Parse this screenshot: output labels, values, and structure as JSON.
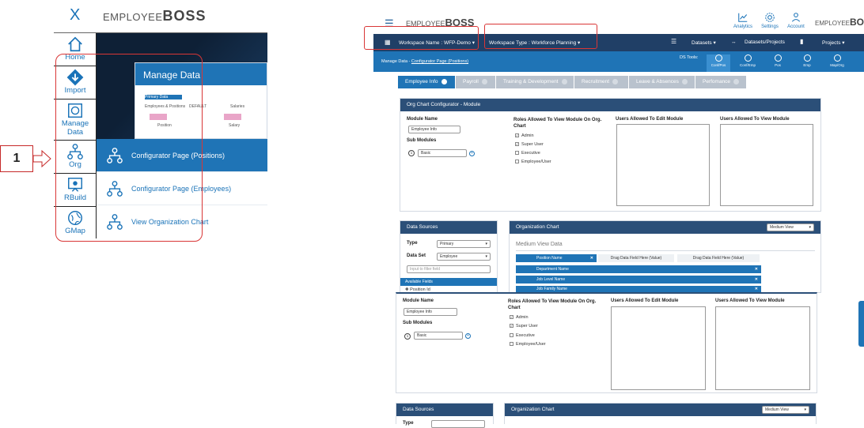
{
  "left": {
    "close": "X",
    "logo_pre": "EMPLOYEE",
    "logo_main": "BOSS",
    "nav": [
      {
        "label": "Home",
        "icon": "home-icon"
      },
      {
        "label": "Import",
        "icon": "import-icon"
      },
      {
        "label": "Manage Data",
        "label2": "Data",
        "label1": "Manage",
        "icon": "manage-data-icon"
      },
      {
        "label": "Org",
        "icon": "org-icon"
      },
      {
        "label": "RBuild",
        "icon": "rbuild-icon"
      },
      {
        "label": "GMap",
        "icon": "gmap-icon"
      }
    ],
    "manage_card_title": "Manage Data",
    "card_primary": "Primary Data",
    "card_emp": "Employees & Positions",
    "card_default": "DEFAULT",
    "card_salaries": "Salaries",
    "card_position": "Position",
    "card_salary": "Salary",
    "org_menu": [
      {
        "label": "Configurator Page (Positions)"
      },
      {
        "label": "Configurator Page (Employees)"
      },
      {
        "label": "View Organization Chart"
      }
    ],
    "callout": "1"
  },
  "right": {
    "logo_pre": "EMPLOYEE",
    "logo_main": "BOSS",
    "top_icons": [
      "Analytics",
      "Settings",
      "Account"
    ],
    "workspace_name": "Workspace Name : WFP-Demo",
    "workspace_type": "Workspace Type : Workforce Planning",
    "menu": [
      "Datasets",
      "Datasets/Projects",
      "Projects"
    ],
    "breadcrumb_root": "Manage Data",
    "breadcrumb_current": "Configurator Page (Positions)",
    "ds_tools_label": "DS Tools:",
    "ds_tools": [
      "Conf/Pos",
      "Conf/Emp",
      "Pos",
      "Emp",
      "Map/Org"
    ],
    "tabs": [
      "Employee Info",
      "Payroll",
      "Training & Development",
      "Recruitment",
      "Leave & Absences",
      "Perfomance"
    ],
    "configurator_title": "Org Chart Configurator - Module",
    "module_name_label": "Module Name",
    "module_name_value": "Employee Info",
    "sub_modules_label": "Sub Modules",
    "sub_module_index": "1",
    "sub_module_value": "Basic",
    "roles_label": "Roles Allowed To View Module On Org. Chart",
    "roles": [
      {
        "label": "Admin",
        "checked": true
      },
      {
        "label": "Super User",
        "checked": true
      },
      {
        "label": "Executive",
        "checked": false
      },
      {
        "label": "Employee/User",
        "checked": false
      }
    ],
    "users_edit_label": "Users Allowed To Edit Module",
    "users_view_label": "Users Allowed To View Module",
    "data_sources_title": "Data Sources",
    "type_label": "Type",
    "type_value": "Primary",
    "dataset_label": "Data Set",
    "dataset_value": "Employee",
    "filter_placeholder": "Input to filter field",
    "available_fields": "Available Fields",
    "field_item": "Position Id",
    "org_chart_title": "Organization Chart",
    "view_select": "Medium View",
    "medium_view_data": "Medium View Data",
    "position_name": "Position Name",
    "drag_here": "Drag Data Field Here (Value)",
    "fields": [
      "Department Name",
      "Job Level Name",
      "Job Family Name"
    ]
  },
  "colors": {
    "accent": "#1f74b6",
    "navy": "#203f66",
    "highlight": "#d93636"
  }
}
